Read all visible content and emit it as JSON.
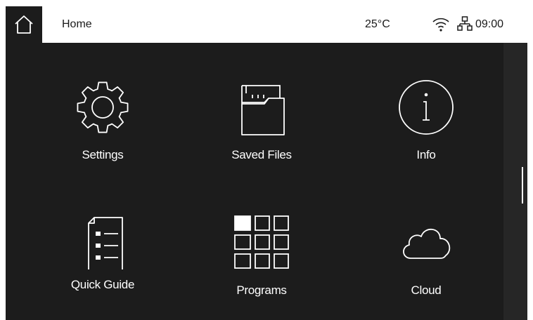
{
  "topbar": {
    "page_title": "Home",
    "temperature": "25°C",
    "time": "09:00"
  },
  "icons": {
    "home": "home-icon",
    "wifi": "wifi-icon",
    "network": "network-icon"
  },
  "tiles": [
    {
      "label": "Settings",
      "icon": "gear-icon"
    },
    {
      "label": "Saved Files",
      "icon": "folder-icon"
    },
    {
      "label": "Info",
      "icon": "info-icon"
    },
    {
      "label": "Quick Guide",
      "icon": "checklist-icon"
    },
    {
      "label": "Programs",
      "icon": "program-grid-icon"
    },
    {
      "label": "Cloud",
      "icon": "cloud-icon"
    }
  ],
  "colors": {
    "background": "#1c1c1c",
    "topbar": "#ffffff",
    "text_light": "#ffffff",
    "text_dark": "#1a1a1a"
  }
}
